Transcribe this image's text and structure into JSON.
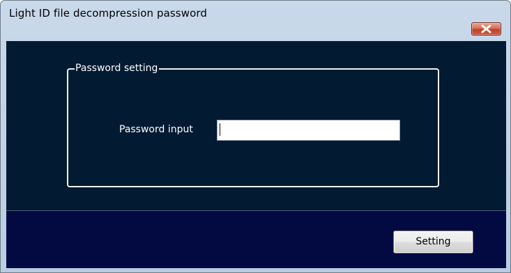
{
  "window": {
    "title": "Light ID file decompression password"
  },
  "title_bar_buttons": {
    "close_icon": "close-icon",
    "close_color": "#c9452c"
  },
  "password_group": {
    "legend": "Password setting",
    "input_label": "Password input",
    "input_value": ""
  },
  "footer": {
    "setting_label": "Setting"
  },
  "colors": {
    "panel_background": "#031a33",
    "footer_background": "#030a42",
    "text": "#ffffff"
  }
}
